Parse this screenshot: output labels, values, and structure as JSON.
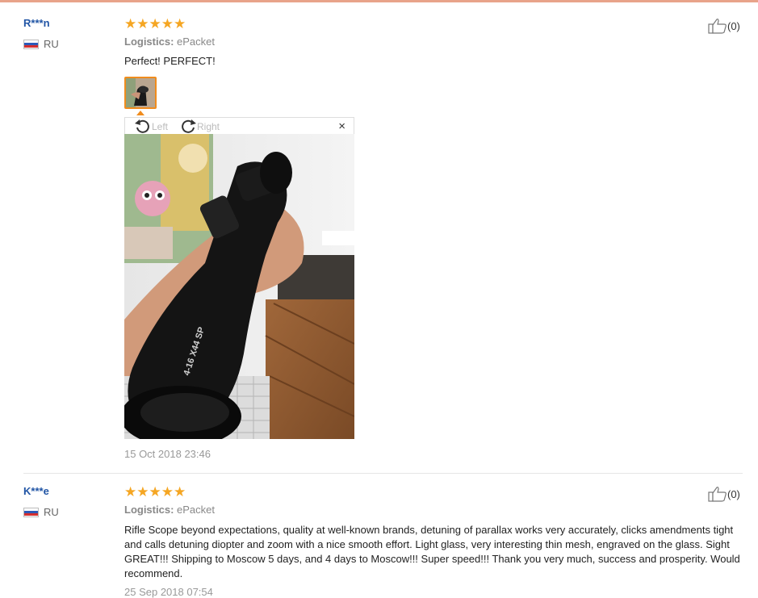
{
  "reviews": [
    {
      "user": "R***n",
      "country": "RU",
      "stars": "★★★★★",
      "rating": 5,
      "logistics_label": "Logistics:",
      "logistics_value": "ePacket",
      "text": "Perfect! PERFECT!",
      "helpful": "(0)",
      "date": "15 Oct 2018 23:46",
      "viewer": {
        "left_label": "Left",
        "right_label": "Right",
        "close": "×",
        "photo_print": "4-16 X44 SP"
      }
    },
    {
      "user": "K***e",
      "country": "RU",
      "stars": "★★★★★",
      "rating": 5,
      "logistics_label": "Logistics:",
      "logistics_value": "ePacket",
      "text": "Rifle Scope beyond expectations, quality at well-known brands, detuning of parallax works very accurately, clicks amendments tight and calls detuning diopter and zoom with a nice smooth effort. Light glass, very interesting thin mesh, engraved on the glass. Sight GREAT!!! Shipping to Moscow 5 days, and 4 days to Moscow!!! Super speed!!! Thank you very much, success and prosperity. Would recommend.",
      "helpful": "(0)",
      "date": "25 Sep 2018 07:54"
    }
  ],
  "colors": {
    "star": "#f5a623",
    "username": "#2155a5",
    "thumb_border": "#f08c1d"
  },
  "icons": {
    "like": "thumbs-up-icon",
    "rotate_left": "rotate-left-icon",
    "rotate_right": "rotate-right-icon",
    "flag": "russia-flag-icon"
  }
}
